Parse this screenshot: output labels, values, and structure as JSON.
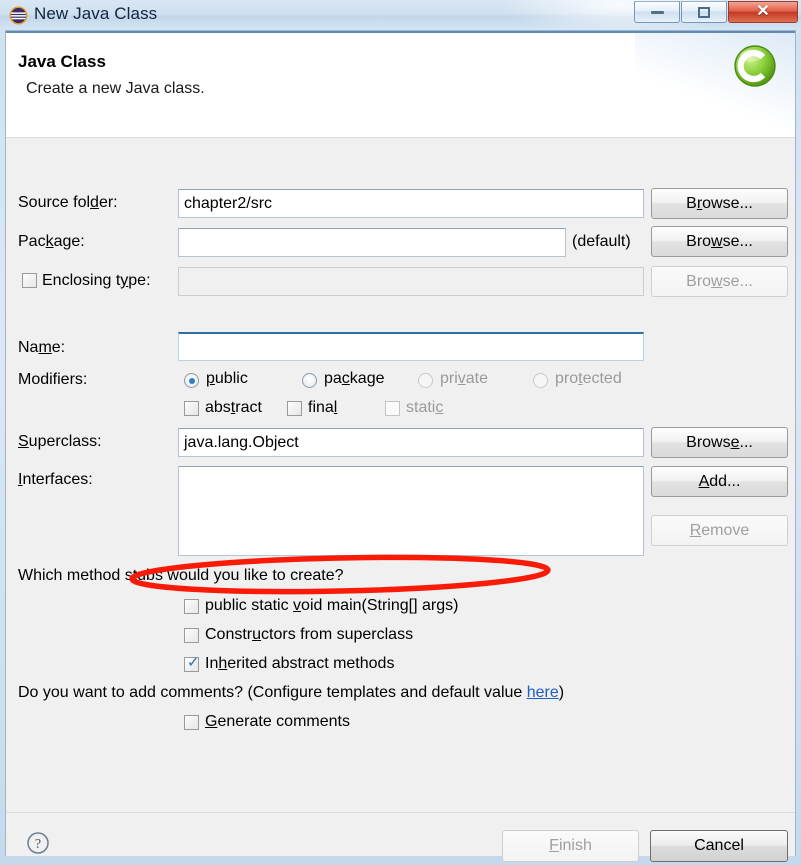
{
  "window": {
    "title": "New Java Class",
    "icon": "eclipse-icon",
    "minimize_label": "Minimize",
    "maximize_label": "Maximize",
    "close_label": "✕"
  },
  "header": {
    "title": "Java Class",
    "subtitle": "Create a new Java class.",
    "icon": "java-class-icon",
    "accent_color": "#5f8bb5",
    "icon_color": "#7dc832"
  },
  "form": {
    "source_folder": {
      "label_pre": "Source fol",
      "label_mnemonic": "d",
      "label_post": "er:",
      "value": "chapter2/src",
      "button": {
        "pre": "B",
        "mnemonic": "r",
        "post": "owse...",
        "enabled": true
      }
    },
    "package": {
      "label_pre": "Pac",
      "label_mnemonic": "k",
      "label_post": "age:",
      "value": "",
      "suffix": "(default)",
      "button": {
        "pre": "Bro",
        "mnemonic": "w",
        "post": "se...",
        "enabled": true
      }
    },
    "enclosing_type": {
      "label_pre": "Enclosing t",
      "label_mnemonic": "y",
      "label_post": "pe:",
      "value": "",
      "checked": false,
      "enabled": false,
      "button": {
        "pre": "Bro",
        "mnemonic": "w",
        "post": "se...",
        "enabled": false
      }
    },
    "name": {
      "label_pre": "Na",
      "label_mnemonic": "m",
      "label_post": "e:",
      "value": "",
      "focused": true
    },
    "modifiers": {
      "label": "Modifiers:",
      "radios": [
        {
          "pre": "",
          "mnemonic": "p",
          "post": "ublic",
          "selected": true,
          "enabled": true
        },
        {
          "pre": "pa",
          "mnemonic": "c",
          "post": "kage",
          "selected": false,
          "enabled": true
        },
        {
          "pre": "pri",
          "mnemonic": "v",
          "post": "ate",
          "selected": false,
          "enabled": false
        },
        {
          "pre": "pro",
          "mnemonic": "t",
          "post": "ected",
          "selected": false,
          "enabled": false
        }
      ],
      "checkboxes": [
        {
          "pre": "abs",
          "mnemonic": "t",
          "post": "ract",
          "checked": false,
          "enabled": true
        },
        {
          "pre": "fina",
          "mnemonic": "l",
          "post": "",
          "checked": false,
          "enabled": true
        },
        {
          "pre": "stati",
          "mnemonic": "c",
          "post": "",
          "checked": false,
          "enabled": false
        }
      ]
    },
    "superclass": {
      "label_pre": "",
      "label_mnemonic": "S",
      "label_post": "uperclass:",
      "value": "java.lang.Object",
      "button": {
        "pre": "Brows",
        "mnemonic": "e",
        "post": "...",
        "enabled": true
      }
    },
    "interfaces": {
      "label_pre": "",
      "label_mnemonic": "I",
      "label_post": "nterfaces:",
      "items": [],
      "add_button": {
        "pre": "",
        "mnemonic": "A",
        "post": "dd...",
        "enabled": true
      },
      "remove_button": {
        "pre": "",
        "mnemonic": "R",
        "post": "emove",
        "enabled": false
      }
    }
  },
  "method_stubs": {
    "question": "Which method stubs would you like to create?",
    "options": [
      {
        "pre": "public static ",
        "mnemonic": "v",
        "post": "oid main(String[] args)",
        "checked": false,
        "annotated": true
      },
      {
        "pre": "Constr",
        "mnemonic": "u",
        "post": "ctors from superclass",
        "checked": false,
        "annotated": false
      },
      {
        "pre": "In",
        "mnemonic": "h",
        "post": "erited abstract methods",
        "checked": true,
        "annotated": false
      }
    ]
  },
  "comments": {
    "question_pre": "Do you want to add comments? (Configure templates and default value ",
    "link_text": "here",
    "question_post": ")",
    "checkbox": {
      "pre": "",
      "mnemonic": "G",
      "post": "enerate comments",
      "checked": false
    }
  },
  "footer": {
    "help_icon": "help-icon",
    "finish": {
      "pre": "",
      "mnemonic": "F",
      "post": "inish",
      "enabled": false
    },
    "cancel": {
      "label": "Cancel",
      "enabled": true
    }
  },
  "annotation": {
    "shape": "ellipse",
    "color": "#f91b07",
    "target": "public static void main(String[] args)"
  }
}
